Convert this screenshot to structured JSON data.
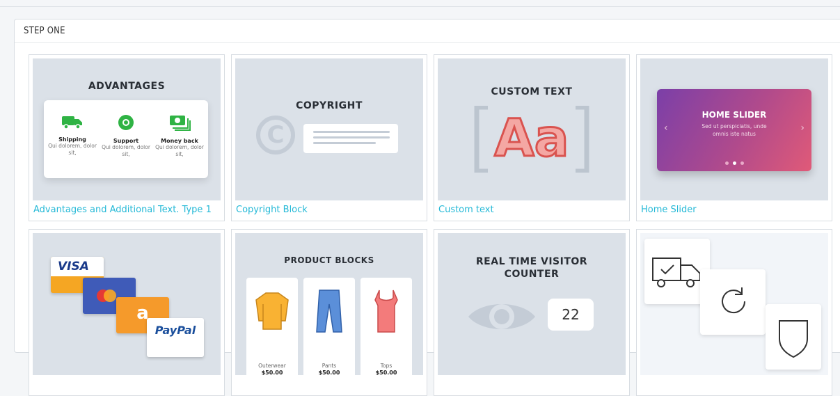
{
  "panel": {
    "title": "STEP ONE"
  },
  "modules": [
    {
      "caption": "Advantages and Additional Text. Type 1",
      "thumb_title": "ADVANTAGES",
      "items": [
        {
          "title": "Shipping",
          "desc": "Qui dolorem, dolor sit,"
        },
        {
          "title": "Support",
          "desc": "Qui dolorem, dolor sit,"
        },
        {
          "title": "Money back",
          "desc": "Qui dolorem, dolor sit,"
        }
      ]
    },
    {
      "caption": "Copyright Block",
      "thumb_title": "COPYRIGHT"
    },
    {
      "caption": "Custom text",
      "thumb_title": "CUSTOM TEXT",
      "glyph": "Aa"
    },
    {
      "caption": "Home Slider",
      "thumb_title": "HOME SLIDER",
      "desc": "Sed ut perspiciatis, unde omnis iste natus"
    },
    {
      "caption": "",
      "brands": [
        "VISA",
        "a",
        "PayPal"
      ]
    },
    {
      "caption": "",
      "thumb_title": "PRODUCT BLOCKS",
      "products": [
        {
          "name": "Outerwear",
          "price": "$50.00"
        },
        {
          "name": "Pants",
          "price": "$50.00"
        },
        {
          "name": "Tops",
          "price": "$50.00"
        }
      ]
    },
    {
      "caption": "",
      "thumb_title": "REAL TIME VISITOR COUNTER",
      "count": "22"
    },
    {
      "caption": ""
    }
  ],
  "colors": {
    "link": "#25b9d7",
    "thumb_bg": "#dbe1e8",
    "green": "#2fb344"
  }
}
